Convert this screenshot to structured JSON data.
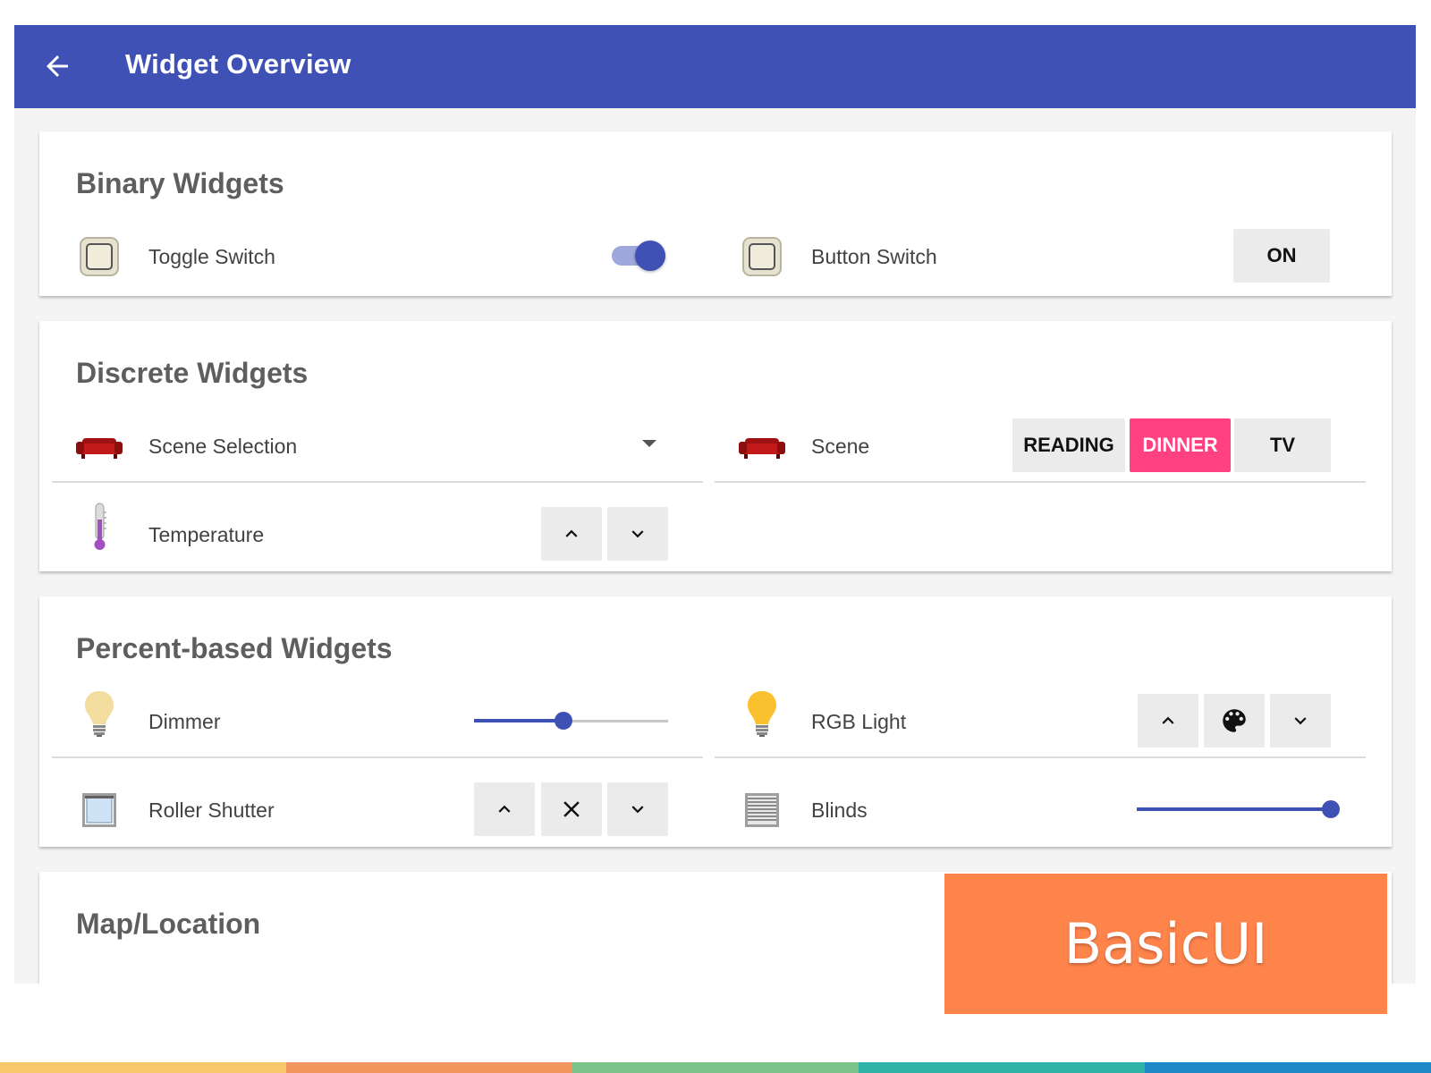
{
  "app_title": "Widget Overview",
  "colors": {
    "primary": "#3f51b5",
    "accent": "#ff4081",
    "badge": "#ff844c",
    "stripes": [
      "#f7c96a",
      "#f0965e",
      "#7ac48c",
      "#2eb3a6",
      "#1e88c7"
    ]
  },
  "binary": {
    "title": "Binary Widgets",
    "toggle": {
      "label": "Toggle Switch",
      "icon": "wall-switch-icon",
      "on": true
    },
    "button_switch": {
      "label": "Button Switch",
      "icon": "wall-switch-icon",
      "button": "ON"
    }
  },
  "discrete": {
    "title": "Discrete Widgets",
    "scene_selection": {
      "label": "Scene Selection",
      "icon": "sofa-icon",
      "dropdown_icon": "dropdown-arrow-icon"
    },
    "scene": {
      "label": "Scene",
      "icon": "sofa-icon",
      "options": [
        "READING",
        "DINNER",
        "TV"
      ],
      "selected": "DINNER"
    },
    "temperature": {
      "label": "Temperature",
      "icon": "thermometer-icon"
    }
  },
  "percent": {
    "title": "Percent-based Widgets",
    "dimmer": {
      "label": "Dimmer",
      "icon": "bulb-icon",
      "value": 46
    },
    "rgb_light": {
      "label": "RGB Light",
      "icon": "bulb-icon"
    },
    "roller_shutter": {
      "label": "Roller Shutter",
      "icon": "window-icon"
    },
    "blinds": {
      "label": "Blinds",
      "icon": "blinds-icon",
      "value": 100
    }
  },
  "map": {
    "title": "Map/Location"
  },
  "badge": "BasicUI"
}
